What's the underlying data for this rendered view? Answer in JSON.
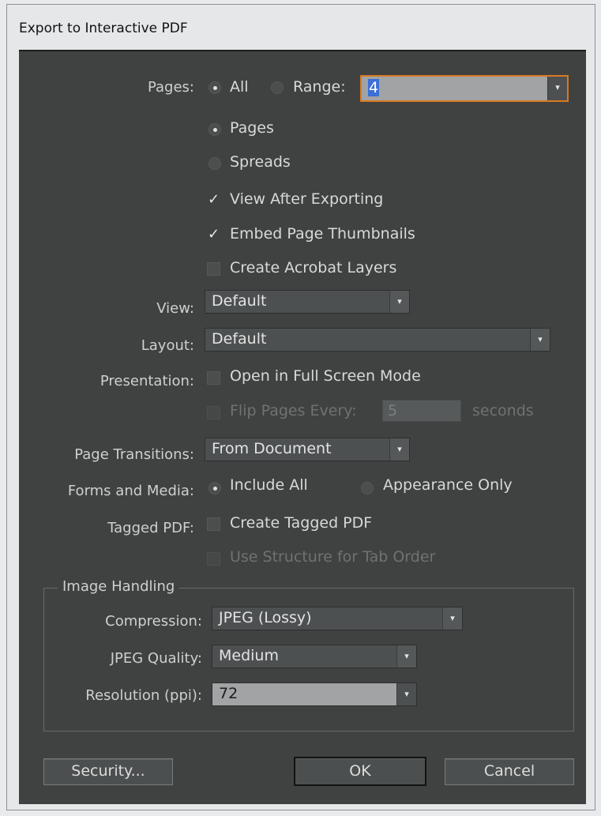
{
  "window": {
    "title": "Export to Interactive PDF"
  },
  "pages": {
    "label": "Pages:",
    "all_label": "All",
    "all_selected": true,
    "range_label": "Range:",
    "range_value": "4",
    "pages_option": "Pages",
    "spreads_option": "Spreads",
    "pages_mode": "Pages"
  },
  "options": {
    "view_after_exporting": {
      "label": "View After Exporting",
      "checked": true
    },
    "embed_page_thumbnails": {
      "label": "Embed Page Thumbnails",
      "checked": true
    },
    "create_acrobat_layers": {
      "label": "Create Acrobat Layers",
      "checked": false
    }
  },
  "view": {
    "label": "View:",
    "value": "Default"
  },
  "layout": {
    "label": "Layout:",
    "value": "Default"
  },
  "presentation": {
    "label": "Presentation:",
    "full_screen_label": "Open in Full Screen Mode",
    "full_screen_checked": false,
    "flip_pages_label": "Flip Pages Every:",
    "flip_pages_value": "5",
    "seconds_label": "seconds"
  },
  "page_transitions": {
    "label": "Page Transitions:",
    "value": "From Document"
  },
  "forms_media": {
    "label": "Forms and Media:",
    "include_all_label": "Include All",
    "appearance_only_label": "Appearance Only",
    "selected": "Include All"
  },
  "tagged_pdf": {
    "label": "Tagged PDF:",
    "create_label": "Create Tagged PDF",
    "create_checked": false,
    "structure_label": "Use Structure for Tab Order"
  },
  "image_handling": {
    "title": "Image Handling",
    "compression_label": "Compression:",
    "compression_value": "JPEG (Lossy)",
    "quality_label": "JPEG Quality:",
    "quality_value": "Medium",
    "resolution_label": "Resolution (ppi):",
    "resolution_value": "72"
  },
  "buttons": {
    "security": "Security...",
    "ok": "OK",
    "cancel": "Cancel"
  },
  "icons": {
    "dropdown_arrow": "▾",
    "checkmark": "✓"
  },
  "colors": {
    "panel": "#3f4241",
    "focus_border": "#d97a22",
    "selection": "#3b6fd6"
  }
}
